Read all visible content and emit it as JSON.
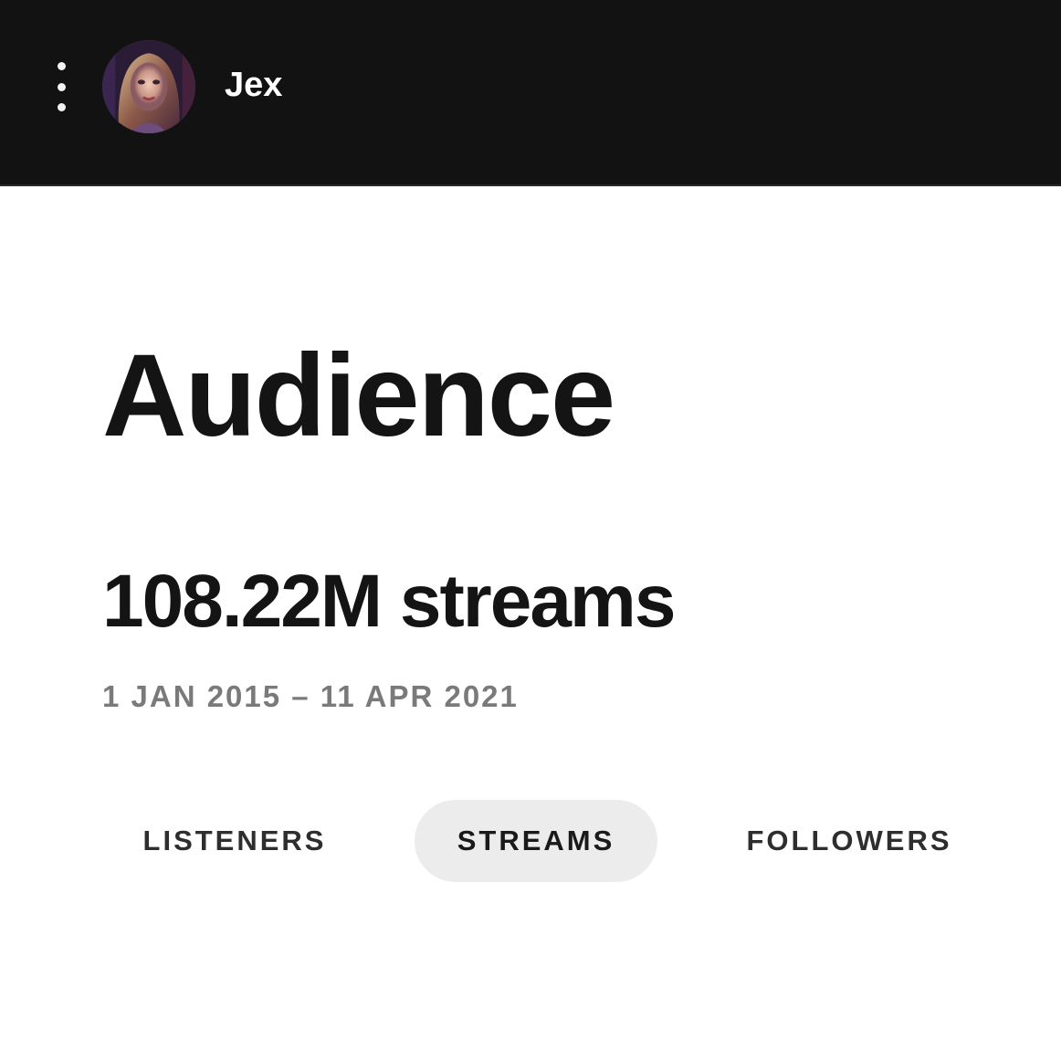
{
  "header": {
    "menu_icon": "vertical-dots-icon",
    "artist_name": "Jex",
    "background": "#121212"
  },
  "main": {
    "title": "Audience",
    "stream_total": "108.22M streams",
    "date_range": "1 JAN 2015 – 11 APR 2021"
  },
  "tabs": [
    {
      "label": "LISTENERS",
      "selected": false
    },
    {
      "label": "STREAMS",
      "selected": true
    },
    {
      "label": "FOLLOWERS",
      "selected": false
    }
  ],
  "colors": {
    "text_primary": "#141414",
    "text_muted": "#7a7a7a",
    "tab_active_bg": "#ececec"
  }
}
